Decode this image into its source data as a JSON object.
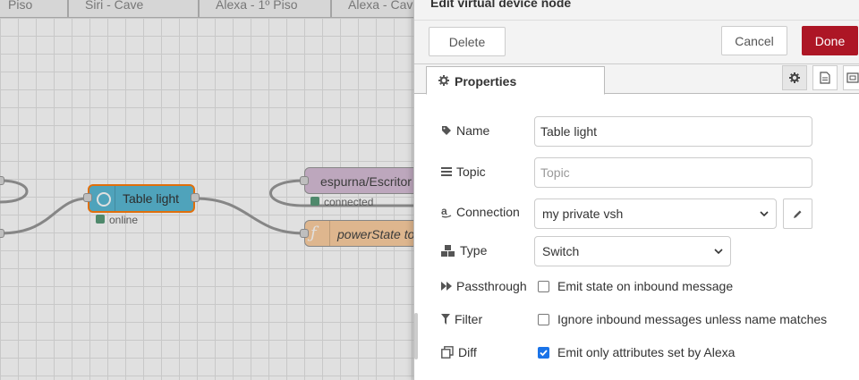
{
  "workspace": {
    "tabs": [
      "Piso",
      "Siri - Cave",
      "Alexa - 1º Piso",
      "Alexa - Cave"
    ],
    "nodes": {
      "table_light": {
        "label": "Table light",
        "status": "online"
      },
      "espurna": {
        "label": "espurna/Escritor",
        "status": "connected"
      },
      "function": {
        "label": "powerState to"
      }
    }
  },
  "tray": {
    "title": "Edit virtual device node",
    "delete_label": "Delete",
    "cancel_label": "Cancel",
    "done_label": "Done",
    "tab_properties": "Properties"
  },
  "form": {
    "name": {
      "label": "Name",
      "value": "Table light"
    },
    "topic": {
      "label": "Topic",
      "value": "",
      "placeholder": "Topic"
    },
    "connection": {
      "label": "Connection",
      "value": "my private vsh"
    },
    "type": {
      "label": "Type",
      "value": "Switch"
    },
    "passthrough": {
      "label": "Passthrough",
      "text": "Emit state on inbound message",
      "checked": false
    },
    "filter": {
      "label": "Filter",
      "text": "Ignore inbound messages unless name matches",
      "checked": false
    },
    "diff": {
      "label": "Diff",
      "text": "Emit only attributes set by Alexa",
      "checked": true
    }
  },
  "colors": {
    "accent": "#ad1625",
    "node_selected": "#5bbad5",
    "node_mqtt": "#d8bfd8",
    "node_function": "#fdd0a2",
    "status_green": "#5a9c7c"
  },
  "icons": [
    "cog-icon",
    "file-icon",
    "frame-icon",
    "tag-icon",
    "list-icon",
    "amazon-icon",
    "cubes-icon",
    "fast-forward-icon",
    "filter-icon",
    "copy-icon",
    "pencil-icon",
    "chevron-down-icon"
  ]
}
